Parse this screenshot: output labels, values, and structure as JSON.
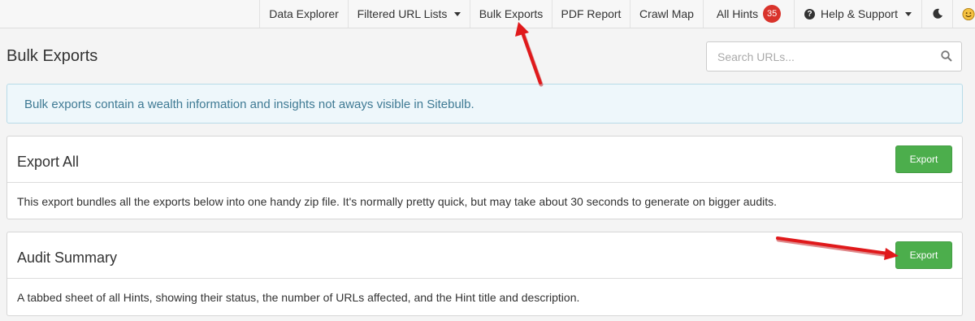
{
  "nav": {
    "items": [
      {
        "label": "Data Explorer"
      },
      {
        "label": "Filtered URL Lists"
      },
      {
        "label": "Bulk Exports"
      },
      {
        "label": "PDF Report"
      },
      {
        "label": "Crawl Map"
      },
      {
        "label": "All Hints",
        "badge": "35"
      },
      {
        "label": "Help & Support"
      }
    ],
    "theme_icon": "moon-icon",
    "avatar_icon": "smiley-face-icon"
  },
  "page": {
    "title": "Bulk Exports",
    "search_placeholder": "Search URLs..."
  },
  "alert": {
    "text": "Bulk exports contain a wealth information and insights not aways visible in Sitebulb."
  },
  "panels": [
    {
      "title": "Export All",
      "button": "Export",
      "description": "This export bundles all the exports below into one handy zip file. It's normally pretty quick, but may take about 30 seconds to generate on bigger audits."
    },
    {
      "title": "Audit Summary",
      "button": "Export",
      "description": "A tabbed sheet of all Hints, showing their status, the number of URLs affected, and the Hint title and description."
    }
  ],
  "colors": {
    "export_button": "#4cae4c",
    "badge": "#d9332b",
    "annotation_arrow": "#e0191b",
    "alert_text": "#3f7a94"
  }
}
